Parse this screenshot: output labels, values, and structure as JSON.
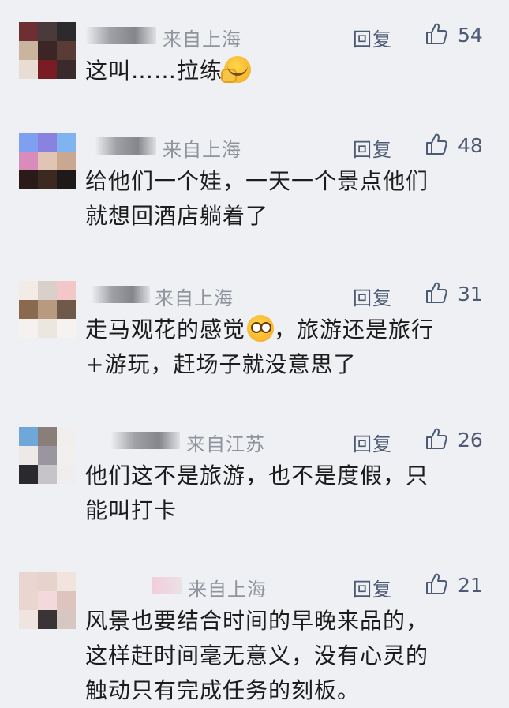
{
  "like_icon": "thumbs-up-icon",
  "comments": [
    {
      "location": "来自上海",
      "reply": "回复",
      "likes": "54",
      "lines": [
        "这叫……拉练"
      ],
      "emoji": "facepalm-emoji"
    },
    {
      "location": "来自上海",
      "reply": "回复",
      "likes": "48",
      "lines": [
        "给他们一个娃，一天一个景点他们",
        "就想回酒店躺着了"
      ]
    },
    {
      "location": "来自上海",
      "reply": "回复",
      "likes": "31",
      "lines": [
        "走马观花的感觉",
        "，旅游还是旅行",
        "+游玩，赶场子就没意思了"
      ],
      "emoji": "dizzy-face-emoji"
    },
    {
      "location": "来自江苏",
      "reply": "回复",
      "likes": "26",
      "lines": [
        "他们这不是旅游，也不是度假，只",
        "能叫打卡"
      ]
    },
    {
      "location": "来自上海",
      "reply": "回复",
      "likes": "21",
      "lines": [
        "风景也要结合时间的早晚来品的，",
        "这样赶时间毫无意义，没有心灵的",
        "触动只有完成任务的刻板。"
      ]
    }
  ]
}
